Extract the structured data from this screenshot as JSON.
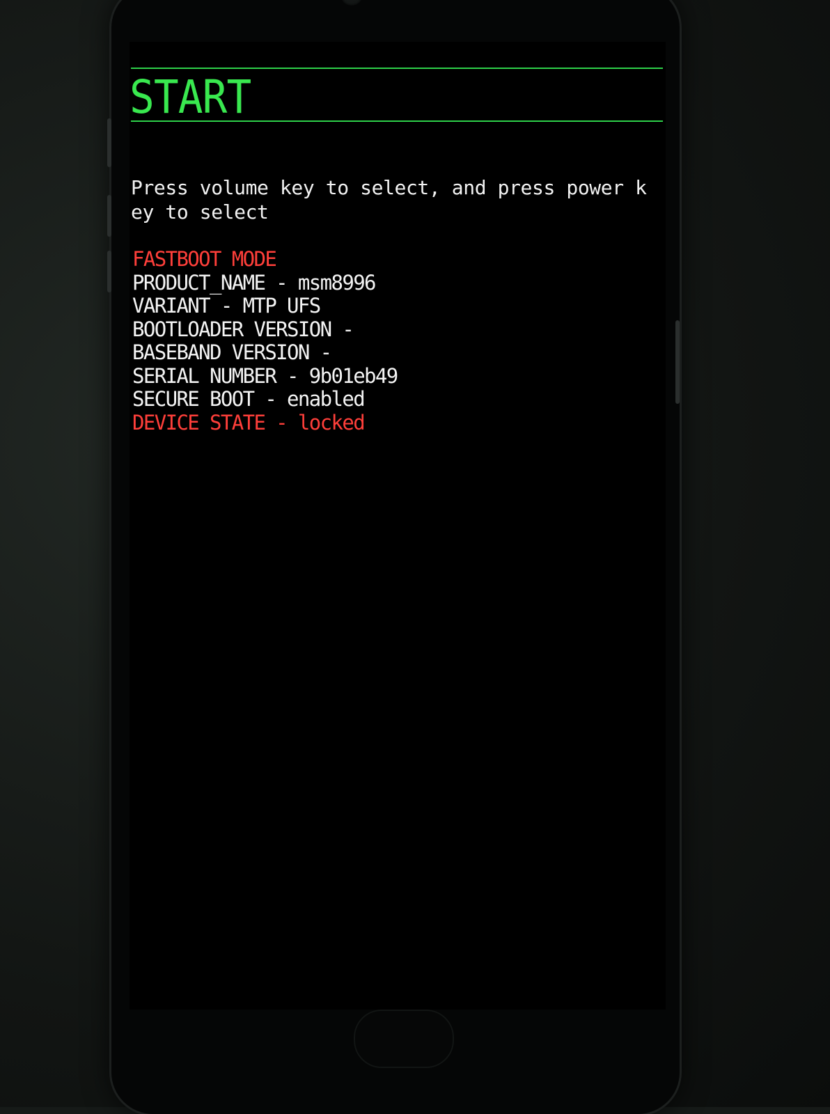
{
  "screen": {
    "title": "START",
    "instructions": "Press volume key to select, and press power k\ney to select",
    "info_lines": [
      {
        "text": "FASTBOOT MODE",
        "color": "#ff3f3a"
      },
      {
        "text": "PRODUCT_NAME - msm8996",
        "color": "#f4f4f4"
      },
      {
        "text": "VARIANT - MTP UFS",
        "color": "#f4f4f4"
      },
      {
        "text": "BOOTLOADER VERSION -",
        "color": "#f4f4f4"
      },
      {
        "text": "BASEBAND VERSION -",
        "color": "#f4f4f4"
      },
      {
        "text": "SERIAL NUMBER - 9b01eb49",
        "color": "#f4f4f4"
      },
      {
        "text": "SECURE BOOT - enabled",
        "color": "#f4f4f4"
      },
      {
        "text": "DEVICE STATE - locked",
        "color": "#ff3f3a"
      }
    ],
    "accent_color": "#39e84f"
  }
}
